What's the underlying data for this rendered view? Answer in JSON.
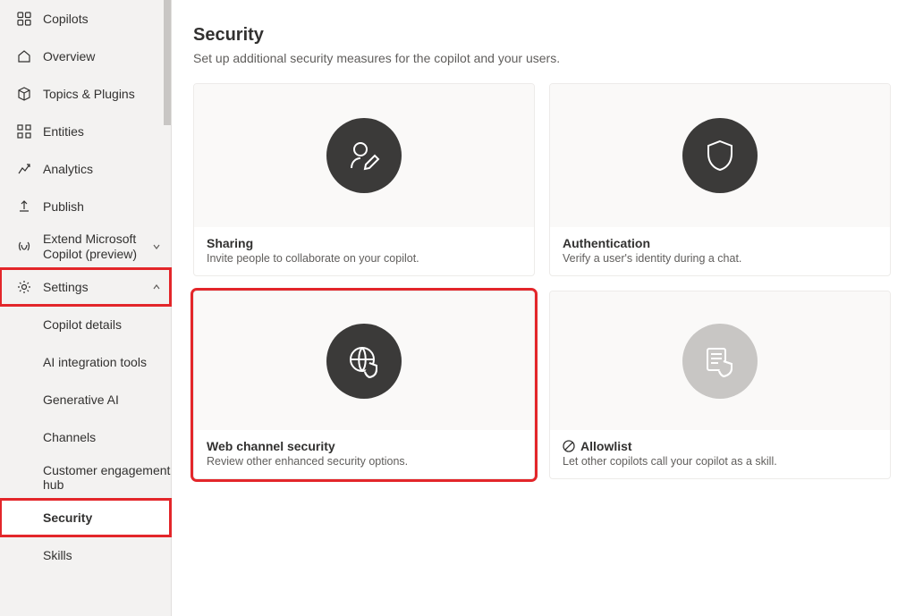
{
  "sidebar": {
    "nav": [
      {
        "label": "Copilots"
      },
      {
        "label": "Overview"
      },
      {
        "label": "Topics & Plugins"
      },
      {
        "label": "Entities"
      },
      {
        "label": "Analytics"
      },
      {
        "label": "Publish"
      },
      {
        "label": "Extend Microsoft Copilot (preview)"
      },
      {
        "label": "Settings"
      }
    ],
    "settings_children": [
      {
        "label": "Copilot details"
      },
      {
        "label": "AI integration tools"
      },
      {
        "label": "Generative AI"
      },
      {
        "label": "Channels"
      },
      {
        "label": "Customer engagement hub"
      },
      {
        "label": "Security"
      },
      {
        "label": "Skills"
      }
    ]
  },
  "main": {
    "title": "Security",
    "subtitle": "Set up additional security measures for the copilot and your users.",
    "cards": [
      {
        "title": "Sharing",
        "desc": "Invite people to collaborate on your copilot."
      },
      {
        "title": "Authentication",
        "desc": "Verify a user's identity during a chat."
      },
      {
        "title": "Web channel security",
        "desc": "Review other enhanced security options."
      },
      {
        "title": "Allowlist",
        "desc": "Let other copilots call your copilot as a skill."
      }
    ]
  }
}
